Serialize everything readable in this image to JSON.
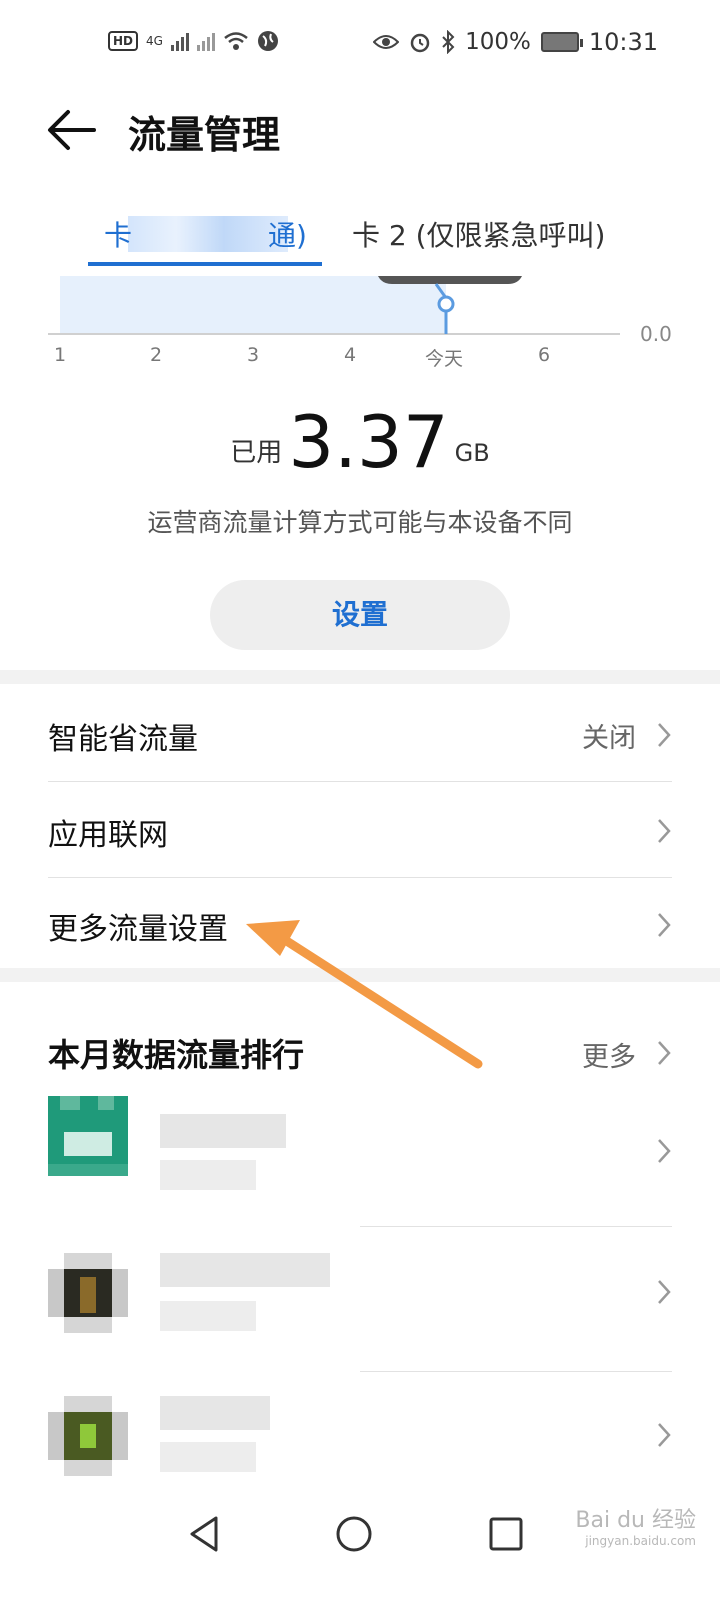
{
  "status": {
    "hd": "HD",
    "network": "4G",
    "battery_percent": "100%",
    "time": "10:31"
  },
  "header": {
    "title": "流量管理",
    "back_icon": "back-arrow-icon"
  },
  "tabs": {
    "tab1_label": "卡",
    "tab1_suffix": "通)",
    "tab2_label": "卡 2 (仅限紧急呼叫)"
  },
  "chart": {
    "x_labels": [
      "1",
      "2",
      "3",
      "4",
      "今天",
      "6"
    ],
    "y_label": "0.0"
  },
  "usage": {
    "prefix": "已用",
    "value": "3.37",
    "unit": "GB",
    "note": "运营商流量计算方式可能与本设备不同",
    "settings_button": "设置"
  },
  "settings": {
    "smart_saver_label": "智能省流量",
    "smart_saver_value": "关闭",
    "app_network_label": "应用联网",
    "more_settings_label": "更多流量设置"
  },
  "ranking": {
    "title": "本月数据流量排行",
    "more_label": "更多"
  },
  "colors": {
    "accent": "#1f6fd1",
    "annotation_arrow": "#f39a45"
  },
  "watermark": {
    "brand": "Bai du 经验",
    "url": "jingyan.baidu.com"
  }
}
